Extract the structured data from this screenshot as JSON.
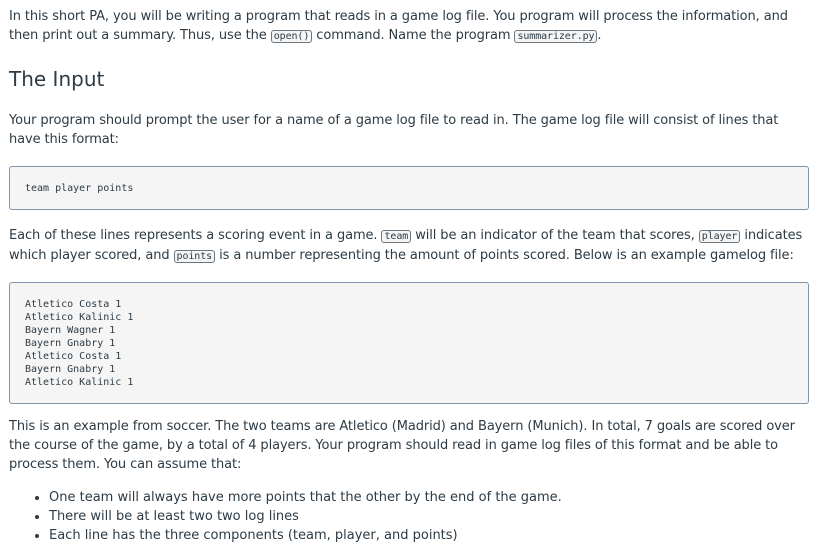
{
  "intro": {
    "text_1": "In this short PA, you will be writing a program that reads in a game log file. You program will process the information, and then print out a summary. Thus, use the ",
    "code_open": "open()",
    "text_2": " command. Name the program ",
    "code_program": "summarizer.py",
    "text_3": "."
  },
  "input_section": {
    "heading": "The Input",
    "prompt_text": "Your program should prompt the user for a name of a game log file to read in. The game log file will consist of lines that have this format:",
    "format_line": "team player points",
    "each_1": "Each of these lines represents a scoring event in a game. ",
    "code_team": "team",
    "each_2": " will be an indicator of the team that scores, ",
    "code_player": "player",
    "each_3": " indicates which player scored, and ",
    "code_points": "points",
    "each_4": " is a number representing the amount of points scored. Below is an example gamelog file:",
    "example_lines": [
      "Atletico Costa 1",
      "Atletico Kalinic 1",
      "Bayern Wagner 1",
      "Bayern Gnabry 1",
      "Atletico Costa 1",
      "Bayern Gnabry 1",
      "Atletico Kalinic 1"
    ],
    "soccer_text": "This is an example from soccer. The two teams are Atletico (Madrid) and Bayern (Munich). In total, 7 goals are scored over the course of the game, by a total of 4 players. Your program should read in game log files of this format and be able to process them. You can assume that:",
    "assumptions": [
      "One team will always have more points that the other by the end of the game.",
      "There will be at least two two log lines",
      "Each line has the three components (team, player, and points)"
    ]
  }
}
